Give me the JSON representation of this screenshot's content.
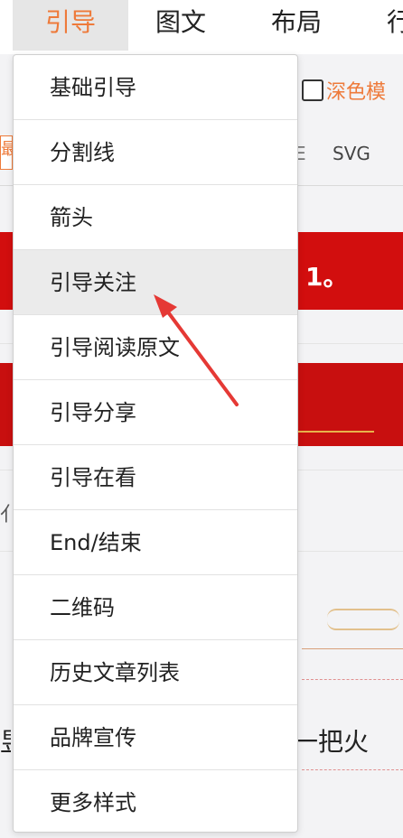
{
  "topnav": {
    "items": [
      "引导",
      "图文",
      "布局",
      "行"
    ],
    "active_index": 0
  },
  "background": {
    "dark_mode_label": "深色模",
    "tab_partial": "最",
    "tab_e_partial": "E",
    "svg_tab": "SVG",
    "red_band_text": "1。",
    "left_char_1": "亻",
    "bottom_right_text": "一把火",
    "bottom_left_char": "昱"
  },
  "menu": {
    "items": [
      "基础引导",
      "分割线",
      "箭头",
      "引导关注",
      "引导阅读原文",
      "引导分享",
      "引导在看",
      "End/结束",
      "二维码",
      "历史文章列表",
      "品牌宣传",
      "更多样式"
    ],
    "hovered_index": 3
  },
  "annotation": {
    "arrow_color": "#e53935"
  },
  "colors": {
    "accent": "#ee7a3a",
    "red_band": "#d20e0e"
  }
}
